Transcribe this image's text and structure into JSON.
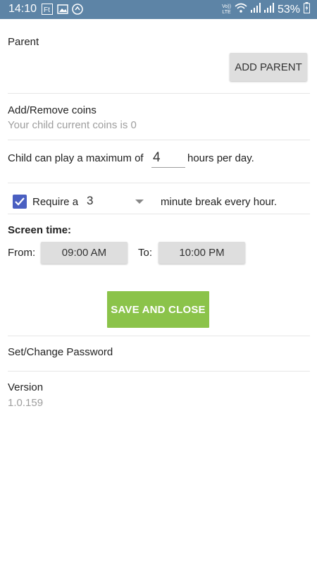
{
  "status_bar": {
    "time": "14:10",
    "network_label_top": "Vo))",
    "network_label_bottom": "LTE",
    "battery": "53%",
    "icons": [
      "app-notification-icon",
      "image-notification-icon",
      "sync-notification-icon",
      "wifi-icon",
      "signal-icon",
      "signal-icon",
      "battery-charging-icon"
    ]
  },
  "parent": {
    "label": "Parent",
    "add_button": "ADD PARENT"
  },
  "coins": {
    "title": "Add/Remove coins",
    "subtitle": "Your child current coins is 0"
  },
  "play_limit": {
    "prefix": "Child can play a maximum of",
    "hours": "4",
    "suffix": "hours per day."
  },
  "break": {
    "checked": true,
    "prefix": "Require a",
    "minutes": "3",
    "suffix": "minute break every hour."
  },
  "screen_time": {
    "title": "Screen time:",
    "from_label": "From:",
    "from_value": "09:00 AM",
    "to_label": "To:",
    "to_value": "10:00 PM"
  },
  "save_button": "SAVE AND CLOSE",
  "password": {
    "label": "Set/Change Password"
  },
  "version": {
    "label": "Version",
    "value": "1.0.159"
  },
  "colors": {
    "status_bar": "#5d84a6",
    "accent_green": "#8bc34a",
    "checkbox": "#4a5fc1"
  }
}
